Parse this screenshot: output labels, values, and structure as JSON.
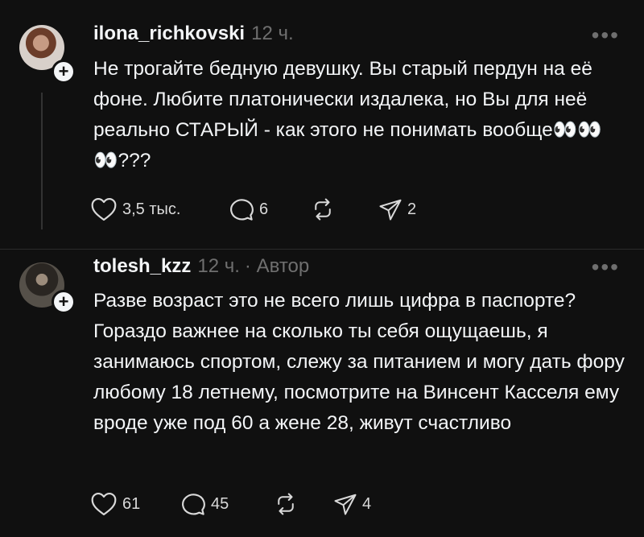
{
  "comments": [
    {
      "username": "ilona_richkovski",
      "time": "12 ч.",
      "author_tag": "",
      "text": "Не трогайте бедную девушку. Вы старый пердун на её фоне. Любите платонически издалека, но Вы для неё реально СТАРЫЙ - как этого не понимать вообще👀👀👀???",
      "likes": "3,5 тыс.",
      "replies": "6",
      "reposts": "",
      "shares": "2",
      "avatar_icon": "user-avatar"
    },
    {
      "username": "tolesh_kzz",
      "time": "12 ч.",
      "author_tag": "· Автор",
      "text": "Разве возраст это не всего лишь цифра в паспорте? Гораздо важнее на сколько ты себя ощущаешь, я занимаюсь спортом, слежу за питанием и могу дать фору любому 18 летнему, посмотрите на Винсент Касселя ему вроде уже под 60 а жене 28, живут счастливо",
      "likes": "61",
      "replies": "45",
      "reposts": "",
      "shares": "4",
      "avatar_icon": "user-avatar"
    }
  ],
  "ui": {
    "more_glyph": "•••",
    "plus_glyph": "+"
  },
  "colors": {
    "background": "#101010",
    "text": "#f3f5f7",
    "muted": "#6f6f6f",
    "divider": "#2b2b2b"
  }
}
